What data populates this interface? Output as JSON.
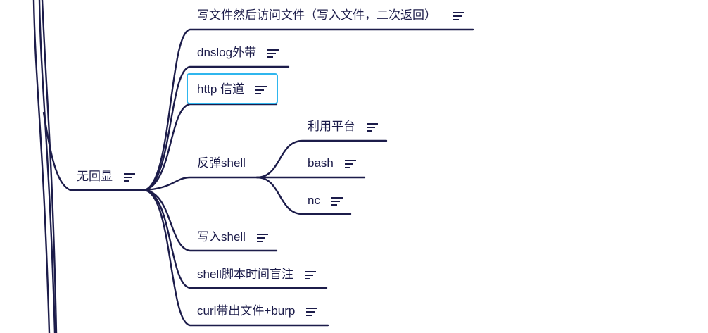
{
  "mindmap": {
    "root": {
      "label": "无回显"
    },
    "children": [
      {
        "id": "write-file",
        "label": "写文件然后访问文件（写入文件，二次返回）"
      },
      {
        "id": "dnslog",
        "label": "dnslog外带"
      },
      {
        "id": "http-channel",
        "label": "http 信道",
        "selected": true
      },
      {
        "id": "reverse-shell",
        "label": "反弹shell",
        "children": [
          {
            "id": "platform",
            "label": "利用平台"
          },
          {
            "id": "bash",
            "label": "bash"
          },
          {
            "id": "nc",
            "label": "nc"
          }
        ]
      },
      {
        "id": "write-shell",
        "label": "写入shell"
      },
      {
        "id": "time-blind",
        "label": "shell脚本时间盲注"
      },
      {
        "id": "curl",
        "label": "curl带出文件+burp"
      }
    ]
  },
  "colors": {
    "line": "#1c1c4a",
    "selection": "#2fb6ee",
    "text": "#1c1c4a"
  },
  "icons": {
    "note": "menu-lines-icon"
  }
}
